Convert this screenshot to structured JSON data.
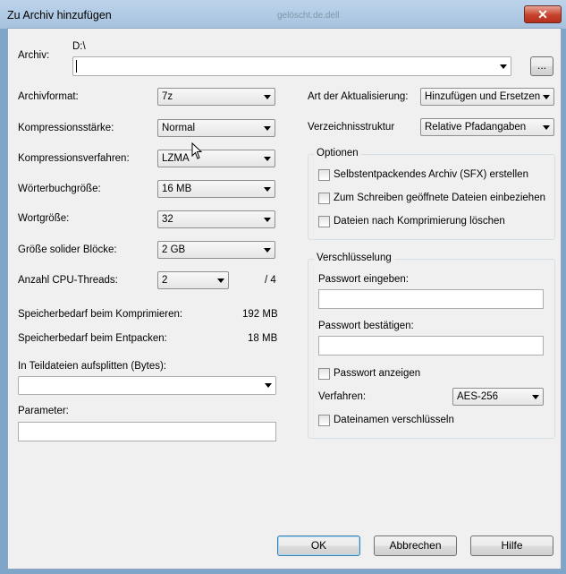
{
  "window": {
    "title": "Zu Archiv hinzufügen",
    "background_text": "gelöscht.de.dell",
    "close_glyph": "✕"
  },
  "archive": {
    "label": "Archiv:",
    "path": "D:\\",
    "browse_label": "..."
  },
  "left": {
    "format": {
      "label": "Archivformat:",
      "value": "7z"
    },
    "level": {
      "label": "Kompressionsstärke:",
      "value": "Normal"
    },
    "method": {
      "label": "Kompressionsverfahren:",
      "value": "LZMA"
    },
    "dict": {
      "label": "Wörterbuchgröße:",
      "value": "16 MB"
    },
    "word": {
      "label": "Wortgröße:",
      "value": "32"
    },
    "solid": {
      "label": "Größe solider Blöcke:",
      "value": "2 GB"
    },
    "threads": {
      "label": "Anzahl CPU-Threads:",
      "value": "2",
      "total": "/ 4"
    },
    "mem_compress": {
      "label": "Speicherbedarf beim Komprimieren:",
      "value": "192 MB"
    },
    "mem_decompress": {
      "label": "Speicherbedarf beim Entpacken:",
      "value": "18 MB"
    },
    "split": {
      "label": "In Teildateien aufsplitten (Bytes):",
      "value": ""
    },
    "params": {
      "label": "Parameter:",
      "value": ""
    }
  },
  "right": {
    "update": {
      "label": "Art der Aktualisierung:",
      "value": "Hinzufügen und Ersetzen"
    },
    "paths": {
      "label": "Verzeichnisstruktur",
      "value": "Relative Pfadangaben"
    },
    "options": {
      "title": "Optionen",
      "sfx": "Selbstentpackendes Archiv (SFX) erstellen",
      "shared": "Zum Schreiben geöffnete Dateien einbeziehen",
      "delete": "Dateien nach Komprimierung löschen"
    },
    "encryption": {
      "title": "Verschlüsselung",
      "pw_label": "Passwort eingeben:",
      "pw_confirm_label": "Passwort bestätigen:",
      "show_pw": "Passwort anzeigen",
      "method_label": "Verfahren:",
      "method_value": "AES-256",
      "encrypt_names": "Dateinamen verschlüsseln"
    }
  },
  "buttons": {
    "ok": "OK",
    "cancel": "Abbrechen",
    "help": "Hilfe"
  }
}
